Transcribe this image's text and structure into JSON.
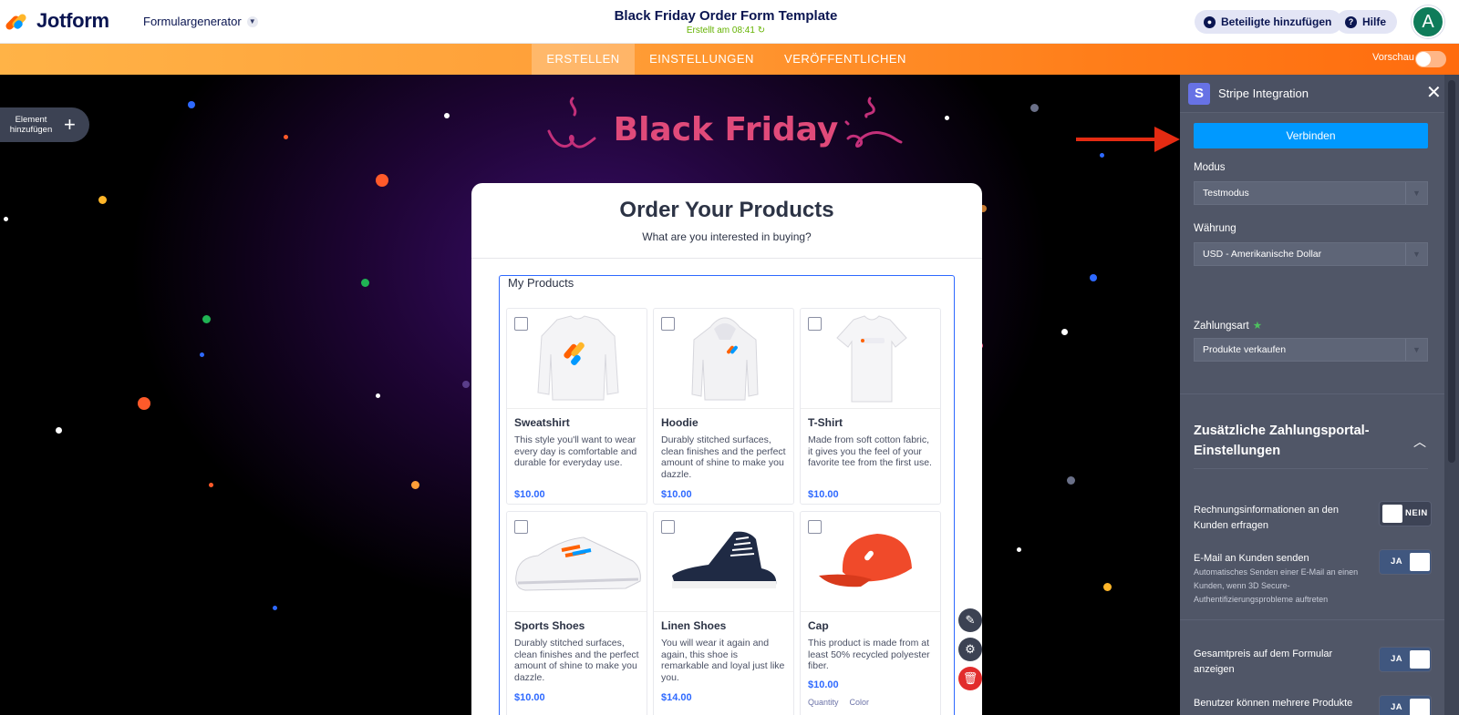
{
  "header": {
    "logo_text": "Jotform",
    "form_generator": "Formulargenerator",
    "form_title": "Black Friday Order Form Template",
    "created": "Erstellt am 08:41",
    "add_participants": "Beteiligte hinzufügen",
    "help": "Hilfe",
    "avatar_letter": "A"
  },
  "nav": {
    "tabs": [
      {
        "label": "ERSTELLEN",
        "active": true
      },
      {
        "label": "EINSTELLUNGEN",
        "active": false
      },
      {
        "label": "VERÖFFENTLICHEN",
        "active": false
      }
    ],
    "preview_label": "Vorschau"
  },
  "canvas": {
    "add_element": "Element hinzufügen",
    "banner_title": "Black Friday"
  },
  "form": {
    "title": "Order Your Products",
    "subtitle": "What are you interested in buying?",
    "products_label": "My Products",
    "products": [
      {
        "name": "Sweatshirt",
        "desc": "This style you'll want to wear every day is comfortable and durable for everyday use.",
        "price": "$10.00"
      },
      {
        "name": "Hoodie",
        "desc": "Durably stitched surfaces, clean finishes and the perfect amount of shine to make you dazzle.",
        "price": "$10.00"
      },
      {
        "name": "T-Shirt",
        "desc": "Made from soft cotton fabric, it gives you the feel of your favorite tee from the first use.",
        "price": "$10.00"
      },
      {
        "name": "Sports Shoes",
        "desc": "Durably stitched surfaces, clean finishes and the perfect amount of shine to make you dazzle.",
        "price": "$10.00"
      },
      {
        "name": "Linen Shoes",
        "desc": "You will wear it again and again, this shoe is remarkable and loyal just like you.",
        "price": "$14.00"
      },
      {
        "name": "Cap",
        "desc": "This product is made from at least 50% recycled polyester fiber.",
        "price": "$10.00"
      }
    ],
    "cap_options": [
      "Quantity",
      "Color"
    ]
  },
  "panel": {
    "title": "Stripe Integration",
    "connect": "Verbinden",
    "mode_label": "Modus",
    "mode_value": "Testmodus",
    "currency_label": "Währung",
    "currency_value": "USD - Amerikanische Dollar",
    "payment_type_label": "Zahlungsart",
    "payment_type_value": "Produkte verkaufen",
    "section_title": "Zusätzliche Zahlungsportal-Einstellungen",
    "options": [
      {
        "label": "Rechnungsinformationen an den Kunden erfragen",
        "state": "NEIN"
      },
      {
        "label": "E-Mail an Kunden senden",
        "desc": "Automatisches Senden einer E-Mail an einen Kunden, wenn 3D Secure-Authentifizierungsprobleme auftreten",
        "state": "JA"
      },
      {
        "label": "Gesamtpreis auf dem Formular anzeigen",
        "state": "JA"
      },
      {
        "label": "Benutzer können mehrere Produkte",
        "state": "JA"
      }
    ]
  },
  "colors": {
    "accent_orange": "#ff8a2a",
    "connect_blue": "#0099ff",
    "price_blue": "#2e69ff",
    "banner_pink": "#e04a7a",
    "arrow_red": "#e42b12"
  }
}
